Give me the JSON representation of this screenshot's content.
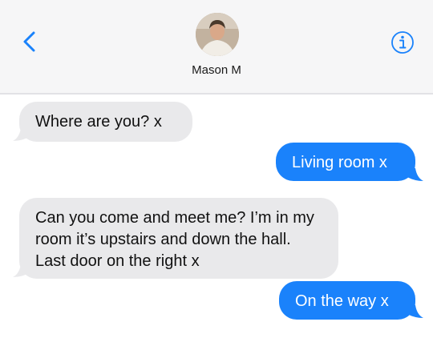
{
  "header": {
    "contact_name": "Mason M",
    "back_icon": "chevron-left-icon",
    "info_icon": "info-circle-icon",
    "accent_color": "#1a82fb"
  },
  "messages": [
    {
      "direction": "incoming",
      "text": "Where are you? x"
    },
    {
      "direction": "outgoing",
      "text": "Living room x"
    },
    {
      "direction": "incoming",
      "text": "Can you come and meet me? I’m in my room it’s upstairs and down the hall. Last door on the right x"
    },
    {
      "direction": "outgoing",
      "text": "On the way x"
    }
  ],
  "colors": {
    "incoming_bubble": "#e9e9eb",
    "outgoing_bubble": "#1a82fb",
    "header_background": "#f6f6f7"
  }
}
